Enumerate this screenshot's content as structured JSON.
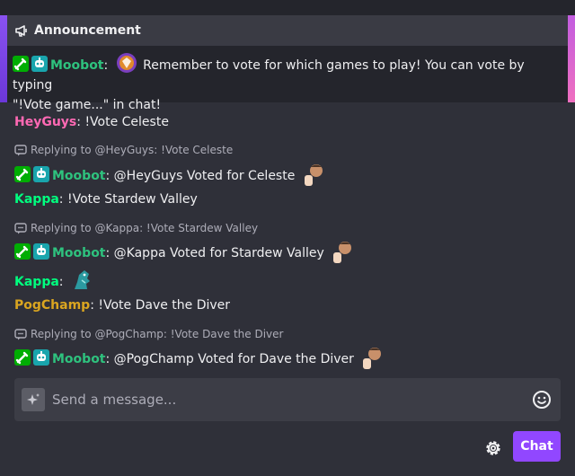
{
  "colors": {
    "background": "#2f3039",
    "moobot": "#2ec27e",
    "heyguys": "#ff69b4",
    "kappa": "#00ff7f",
    "pogchamp": "#daa520",
    "accent": "#9147ff"
  },
  "announcement": {
    "title": "Announcement",
    "icon": "megaphone-icon",
    "author": "Moobot",
    "text_line1": "Remember to vote for which games to play! You can vote by typing",
    "text_line2": "\"!Vote game...\" in chat!"
  },
  "messages": [
    {
      "user": "HeyGuys",
      "text": "!Vote Celeste"
    },
    {
      "reply": "Replying to @HeyGuys: !Vote Celeste",
      "user": "Moobot",
      "text": "@HeyGuys Voted for Celeste"
    },
    {
      "user": "Kappa",
      "text": "!Vote Stardew Valley"
    },
    {
      "reply": "Replying to @Kappa: !Vote Stardew Valley",
      "user": "Moobot",
      "text": "@Kappa Voted for Stardew Valley"
    },
    {
      "user": "Kappa",
      "text": ""
    },
    {
      "user": "PogChamp",
      "text": "!Vote Dave the Diver"
    },
    {
      "reply": "Replying to @PogChamp: !Vote Dave the Diver",
      "user": "Moobot",
      "text": "@PogChamp Voted for Dave the Diver"
    }
  ],
  "composer": {
    "placeholder": "Send a message...",
    "chat_button": "Chat"
  },
  "icons": [
    "megaphone-icon",
    "moderator-badge-icon",
    "bot-badge-icon",
    "reply-icon",
    "sparkle-icon",
    "emoji-icon",
    "gear-icon"
  ]
}
